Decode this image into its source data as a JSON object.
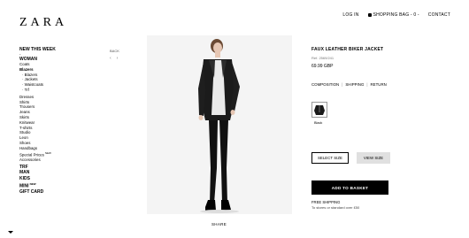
{
  "brand": {
    "logo": "ZARA"
  },
  "topnav": {
    "login": "LOG IN",
    "bag": "SHOPPING BAG - 0 -",
    "contact": "CONTACT"
  },
  "sidebar": {
    "new_this_week": "NEW THIS WEEK",
    "dash": "-",
    "woman": "WOMAN",
    "coats": "Coats",
    "blazers": "Blazers",
    "blazers_sub": [
      "· Blazers",
      "· Jackets",
      "· Waistcoats",
      "· Trf"
    ],
    "items_a": [
      "Dresses",
      "Shirts",
      "Trousers",
      "Jeans",
      "Skirts",
      "Knitwear",
      "T-shirts",
      "Studio",
      "Leon",
      "Shoes",
      "Handbags"
    ],
    "special_prices": "Special Prices",
    "new_badge": "NEW",
    "accessories": "Accessories",
    "trf": "TRF",
    "man": "MAN",
    "kids": "KIDS",
    "mini": "MINI",
    "gift_card": "GIFT CARD"
  },
  "pager": {
    "back": "BACK",
    "prev": "‹",
    "next": "›"
  },
  "product": {
    "title": "FAUX LEATHER BIKER JACKET",
    "ref": "Ref. 2569/241",
    "price": "69.99 GBP",
    "composition": "COMPOSITION",
    "shipping": "SHIPPING",
    "return": "RETURN",
    "separator": "|",
    "color_label": "Black",
    "select_size": "SELECT SIZE",
    "view_size": "VIEW SIZE",
    "add_to_basket": "ADD TO BASKET",
    "free_shipping": "FREE SHIPPING",
    "free_shipping_note": "To stores or standard over £50"
  },
  "share": "SHARE"
}
